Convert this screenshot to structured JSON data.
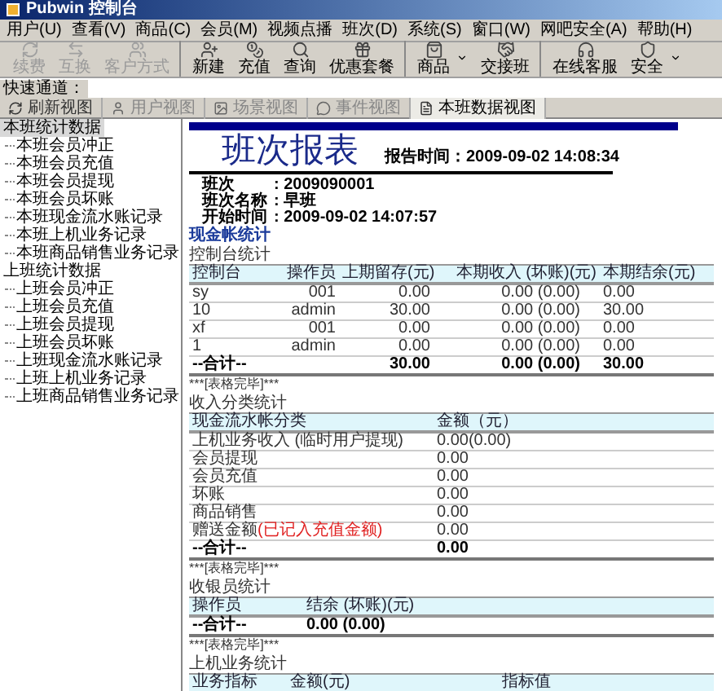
{
  "window": {
    "title": "Pubwin 控制台"
  },
  "menu": [
    "用户(U)",
    "查看(V)",
    "商品(C)",
    "会员(M)",
    "视频点播",
    "班次(D)",
    "系统(S)",
    "窗口(W)",
    "网吧安全(A)",
    "帮助(H)"
  ],
  "toolbar": [
    {
      "label": "续费",
      "kind": "renew",
      "disabled": true,
      "dropdown": false,
      "sep": false
    },
    {
      "label": "互换",
      "kind": "swap",
      "disabled": true,
      "dropdown": false,
      "sep": false
    },
    {
      "label": "客户方式",
      "kind": "users",
      "disabled": true,
      "dropdown": false,
      "sep": true
    },
    {
      "label": "新建",
      "kind": "new",
      "disabled": false,
      "dropdown": false,
      "sep": false
    },
    {
      "label": "充值",
      "kind": "coins",
      "disabled": false,
      "dropdown": false,
      "sep": false
    },
    {
      "label": "查询",
      "kind": "search",
      "disabled": false,
      "dropdown": false,
      "sep": false
    },
    {
      "label": "优惠套餐",
      "kind": "gift",
      "disabled": false,
      "dropdown": false,
      "sep": true
    },
    {
      "label": "商品",
      "kind": "bag",
      "disabled": false,
      "dropdown": true,
      "sep": false
    },
    {
      "label": "交接班",
      "kind": "handover",
      "disabled": false,
      "dropdown": false,
      "sep": true
    },
    {
      "label": "在线客服",
      "kind": "support",
      "disabled": false,
      "dropdown": false,
      "sep": false
    },
    {
      "label": "安全",
      "kind": "shield",
      "disabled": false,
      "dropdown": true,
      "sep": false
    }
  ],
  "quick_channel": {
    "label": "快速通道："
  },
  "tabs": [
    {
      "label": "刷新视图",
      "kind": "refresh",
      "selected": false,
      "disabled": false
    },
    {
      "label": "用户视图",
      "kind": "user",
      "selected": false,
      "disabled": true
    },
    {
      "label": "场景视图",
      "kind": "scene",
      "selected": false,
      "disabled": true
    },
    {
      "label": "事件视图",
      "kind": "event",
      "selected": false,
      "disabled": true
    },
    {
      "label": "本班数据视图",
      "kind": "doc",
      "selected": true,
      "disabled": false
    }
  ],
  "sidebar": {
    "items": [
      {
        "label": "本班统计数据",
        "selected": true,
        "children": [
          {
            "label": "本班会员冲正"
          },
          {
            "label": "本班会员充值"
          },
          {
            "label": "本班会员提现"
          },
          {
            "label": "本班会员坏账"
          },
          {
            "label": "本班现金流水账记录"
          },
          {
            "label": "本班上机业务记录"
          },
          {
            "label": "本班商品销售业务记录"
          }
        ]
      },
      {
        "label": "上班统计数据",
        "selected": false,
        "children": [
          {
            "label": "上班会员冲正"
          },
          {
            "label": "上班会员充值"
          },
          {
            "label": "上班会员提现"
          },
          {
            "label": "上班会员坏账"
          },
          {
            "label": "上班现金流水账记录"
          },
          {
            "label": "上班上机业务记录"
          },
          {
            "label": "上班商品销售业务记录"
          }
        ]
      }
    ]
  },
  "report": {
    "title": "班次报表",
    "report_time": "报告时间：2009-09-02 14:08:34",
    "info": [
      {
        "label": "班次",
        "value": ": 2009090001"
      },
      {
        "label": "班次名称",
        "value": ": 早班"
      },
      {
        "label": "开始时间",
        "value": ": 2009-09-02 14:07:57"
      }
    ],
    "section": "现金帐统计",
    "tables": [
      {
        "title": "控制台统计",
        "columns": [
          "控制台",
          "操作员",
          "上期留存(元)",
          "本期收入 (坏账)(元)",
          "本期结余(元)"
        ],
        "rows": [
          [
            "sy",
            "001",
            "0.00",
            "0.00 (0.00)",
            "0.00"
          ],
          [
            "10",
            "admin",
            "30.00",
            "0.00 (0.00)",
            "30.00"
          ],
          [
            "xf",
            "001",
            "0.00",
            "0.00 (0.00)",
            "0.00"
          ],
          [
            "1",
            "admin",
            "0.00",
            "0.00 (0.00)",
            "0.00"
          ]
        ],
        "total": {
          "label": "--合计--",
          "values": [
            "30.00",
            "0.00 (0.00)",
            "30.00"
          ]
        },
        "end": "***[表格完毕]***"
      },
      {
        "title": "收入分类统计",
        "columns": [
          "现金流水帐分类",
          "金额（元）"
        ],
        "rows": [
          [
            "上机业务收入 (临时用户提现)",
            "0.00(0.00)"
          ],
          [
            "会员提现",
            "0.00"
          ],
          [
            "会员充值",
            "0.00"
          ],
          [
            "坏账",
            "0.00"
          ],
          [
            "商品销售",
            "0.00"
          ],
          {
            "category": "赠送金额",
            "note": "(已记入充值金额)",
            "amount": "0.00"
          }
        ],
        "total": {
          "label": "--合计--",
          "values": [
            "0.00"
          ]
        },
        "end": "***[表格完毕]***"
      },
      {
        "title": "收银员统计",
        "columns": [
          "操作员",
          "结余 (坏账)(元)"
        ],
        "total": {
          "label": "--合计--",
          "values": [
            "0.00 (0.00)"
          ]
        },
        "end": "***[表格完毕]***"
      },
      {
        "title": "上机业务统计",
        "columns": [
          "业务指标",
          "金额(元)",
          "指标值"
        ]
      }
    ]
  }
}
